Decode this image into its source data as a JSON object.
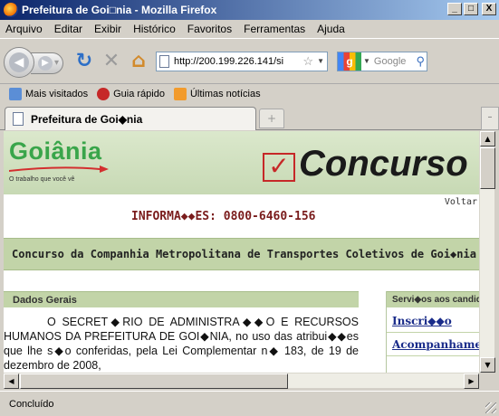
{
  "window": {
    "title": "Prefeitura de Goi□nia - Mozilla Firefox",
    "min_label": "_",
    "max_label": "□",
    "close_label": "X"
  },
  "menu": [
    {
      "label": "Arquivo"
    },
    {
      "label": "Editar"
    },
    {
      "label": "Exibir"
    },
    {
      "label": "Histórico"
    },
    {
      "label": "Favoritos"
    },
    {
      "label": "Ferramentas"
    },
    {
      "label": "Ajuda"
    }
  ],
  "toolbar": {
    "url": "http://200.199.226.141/si",
    "search_placeholder": "Google"
  },
  "bookmarks": [
    {
      "label": "Mais visitados",
      "icon": "most-visited-icon"
    },
    {
      "label": "Guia rápido",
      "icon": "quick-guide-icon"
    },
    {
      "label": "Últimas notícias",
      "icon": "rss-icon"
    }
  ],
  "tab": {
    "label": "Prefeitura de Goi◆nia",
    "new_tab": "+"
  },
  "page": {
    "logo": "Goiânia",
    "logo_tagline": "O trabalho que você vê",
    "banner": "Concurso",
    "voltar": "Voltar",
    "info_phone": "INFORMA◆◆ES: 0800-6460-156",
    "section_title": "Concurso da Companhia Metropolitana de Transportes Coletivos de Goi◆nia",
    "left_panel_title": "Dados Gerais",
    "body_text": "O SECRET◆RIO DE ADMINISTRA◆◆O E RECURSOS HUMANOS DA PREFEITURA DE GOI◆NIA, no uso das atribui◆◆es que lhe s◆o conferidas, pela Lei Complementar n◆ 183, de 19 de dezembro de 2008,",
    "right_panel_title": "Servi◆os aos candidatos",
    "links": [
      "Inscri◆◆o",
      "Acompanhamento"
    ]
  },
  "status": {
    "text": "Concluído"
  },
  "colors": {
    "accent_green": "#39a54a",
    "header_band": "#c2d4a8",
    "phone_red": "#7a1c1c",
    "link_blue": "#1a2c8a"
  }
}
